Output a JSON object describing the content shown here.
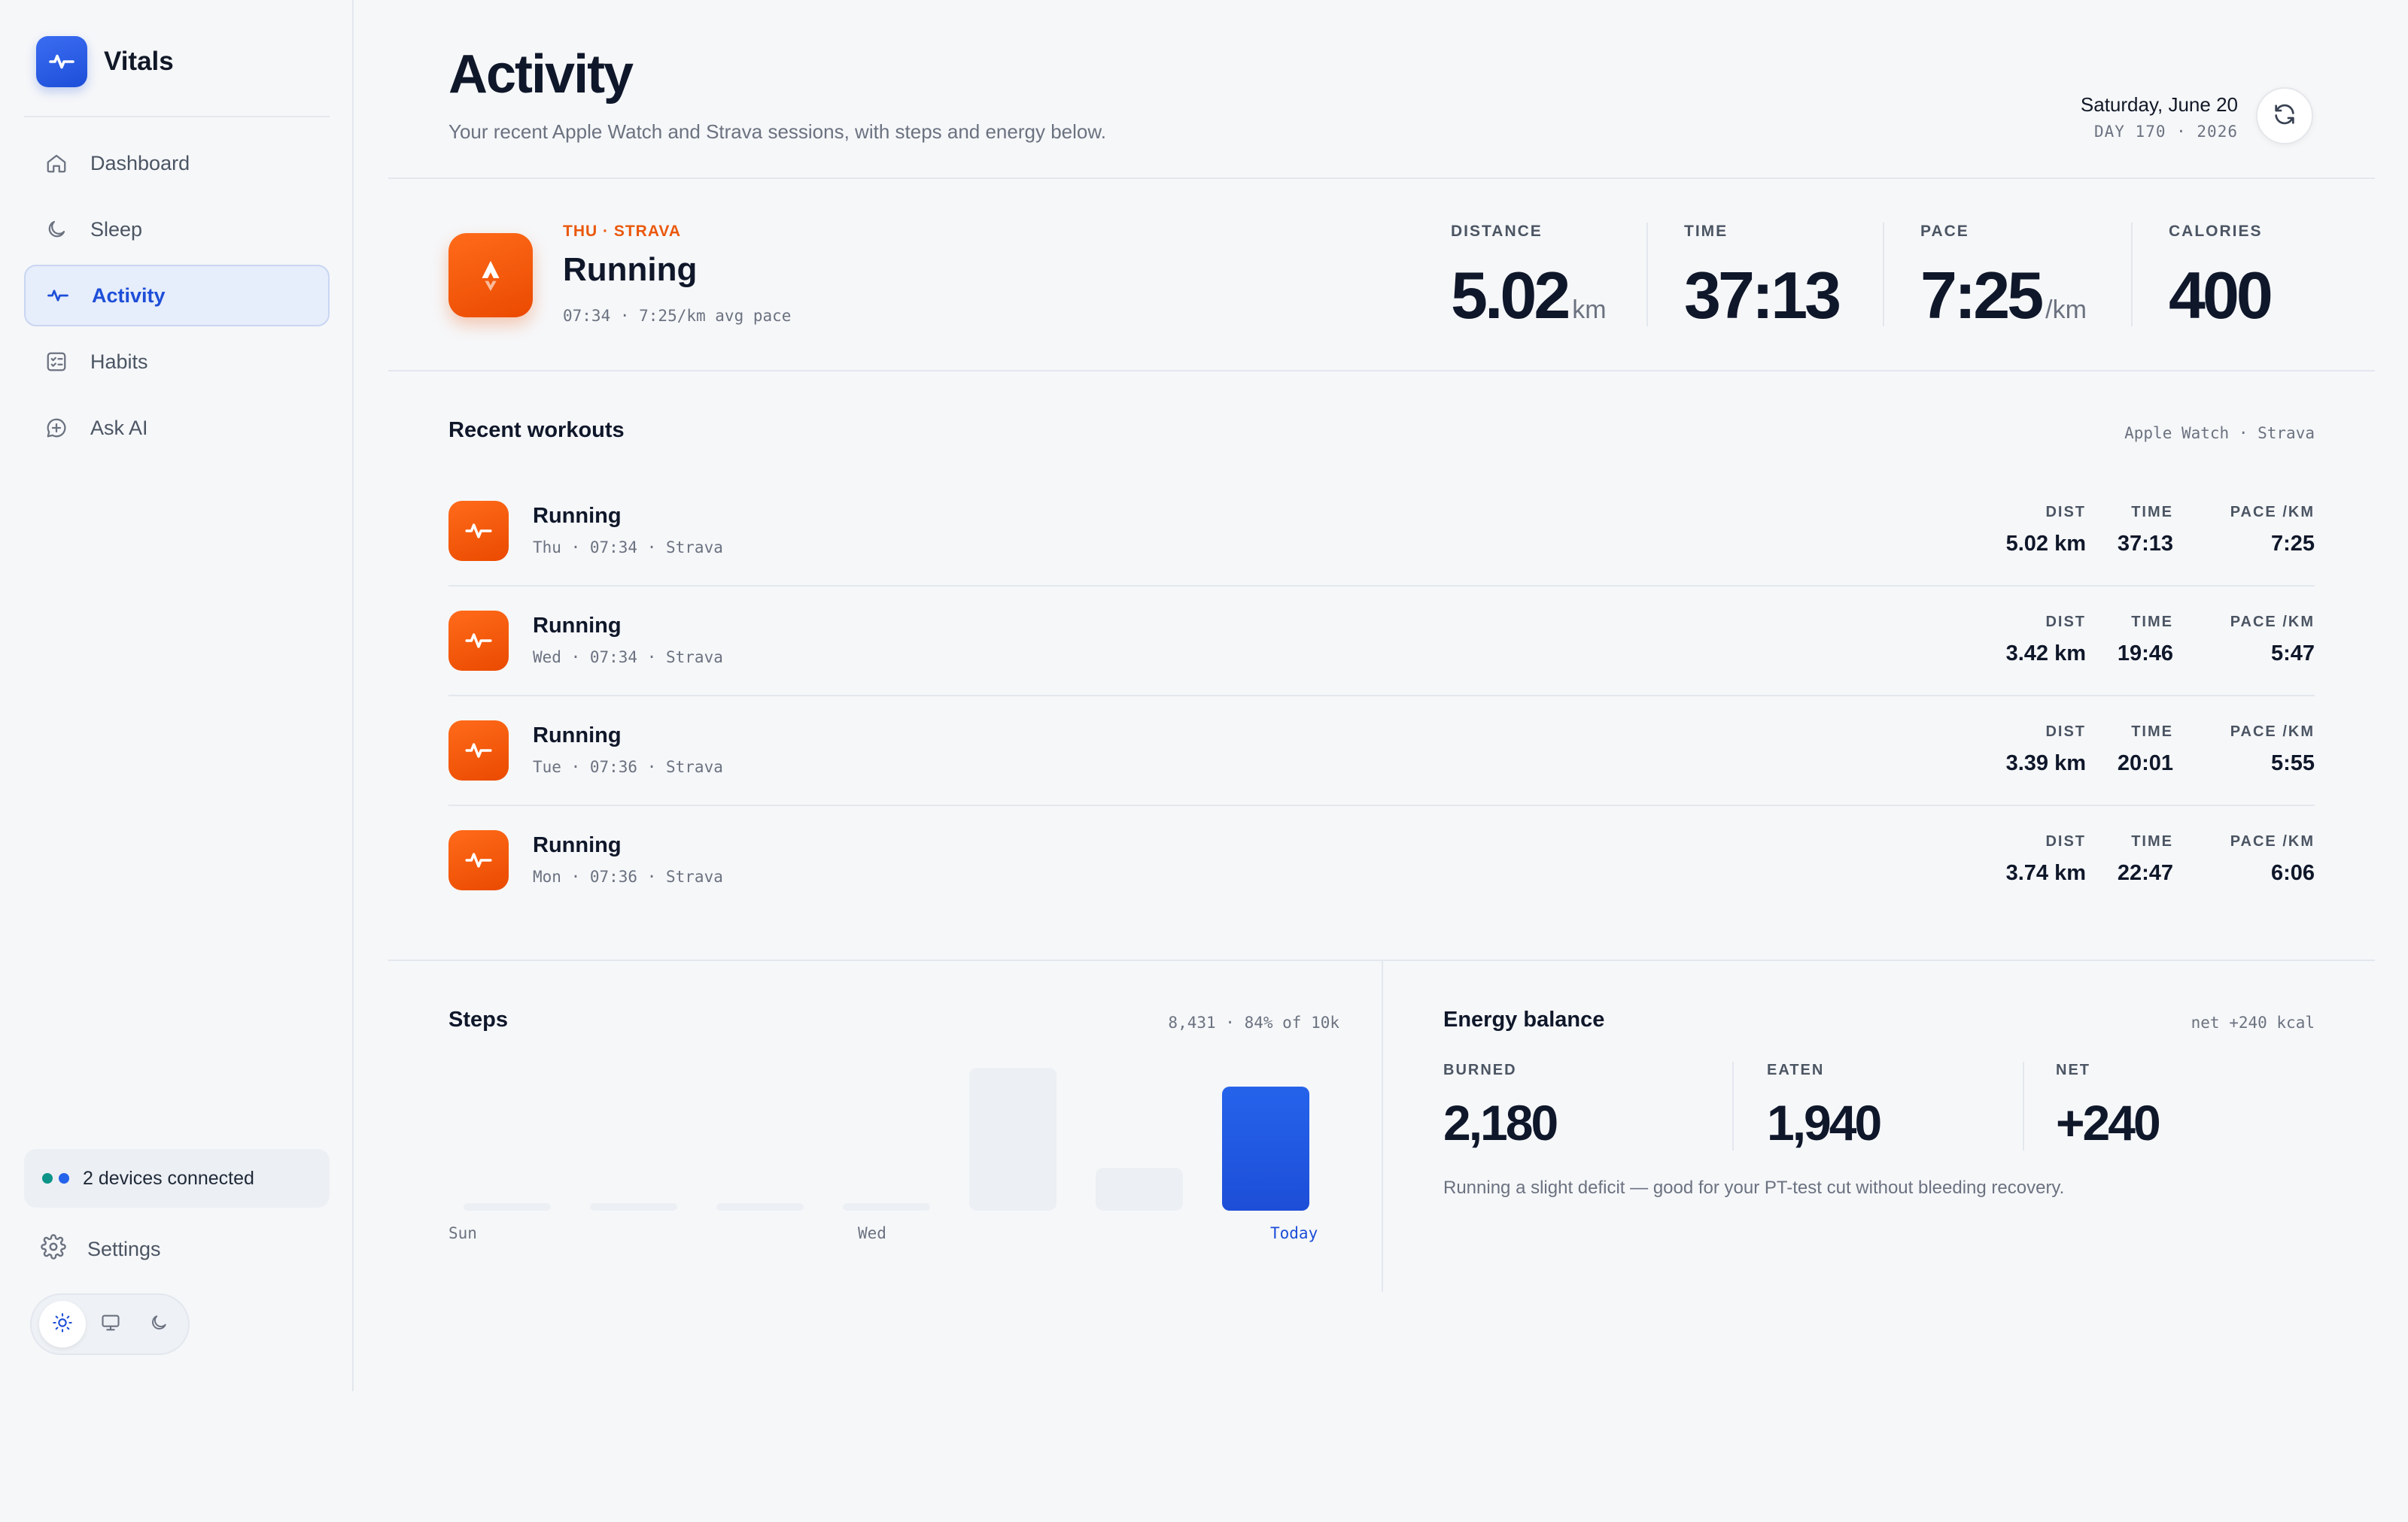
{
  "app": {
    "name": "Vitals"
  },
  "sidebar": {
    "items": [
      {
        "label": "Dashboard",
        "icon": "home-icon"
      },
      {
        "label": "Sleep",
        "icon": "moon-icon"
      },
      {
        "label": "Activity",
        "icon": "pulse-icon",
        "active": true
      },
      {
        "label": "Habits",
        "icon": "checklist-icon"
      },
      {
        "label": "Ask AI",
        "icon": "chat-sparkle-icon"
      }
    ],
    "devices": {
      "label": "2 devices connected",
      "dot_colors": [
        "#0d9488",
        "#2563eb"
      ]
    },
    "settings": {
      "label": "Settings",
      "icon": "gear-icon"
    },
    "theme": {
      "options": [
        "sun-icon",
        "monitor-icon",
        "moon-icon"
      ],
      "selected": "sun-icon"
    }
  },
  "header": {
    "title": "Activity",
    "subtitle": "Your recent Apple Watch and Strava sessions, with steps and energy below.",
    "date": "Saturday, June 20",
    "date_sub": "DAY 170 · 2026"
  },
  "hero": {
    "eyebrow": "THU · STRAVA",
    "title": "Running",
    "meta": "07:34 · 7:25/km avg pace",
    "stats": [
      {
        "label": "DISTANCE",
        "value": "5.02",
        "unit": "km"
      },
      {
        "label": "TIME",
        "value": "37:13",
        "unit": ""
      },
      {
        "label": "PACE",
        "value": "7:25",
        "unit": "/km"
      },
      {
        "label": "CALORIES",
        "value": "400",
        "unit": ""
      }
    ]
  },
  "workouts": {
    "title": "Recent workouts",
    "source_note": "Apple Watch · Strava",
    "columns": [
      "DIST",
      "TIME",
      "PACE /KM"
    ],
    "rows": [
      {
        "title": "Running",
        "meta": "Thu · 07:34 · Strava",
        "dist": "5.02 km",
        "time": "37:13",
        "pace": "7:25"
      },
      {
        "title": "Running",
        "meta": "Wed · 07:34 · Strava",
        "dist": "3.42 km",
        "time": "19:46",
        "pace": "5:47"
      },
      {
        "title": "Running",
        "meta": "Tue · 07:36 · Strava",
        "dist": "3.39 km",
        "time": "20:01",
        "pace": "5:55"
      },
      {
        "title": "Running",
        "meta": "Mon · 07:36 · Strava",
        "dist": "3.74 km",
        "time": "22:47",
        "pace": "6:06"
      }
    ]
  },
  "steps": {
    "title": "Steps",
    "summary": "8,431 · 84% of 10k",
    "labels": {
      "first": "Sun",
      "middle": "Wed",
      "last": "Today"
    },
    "daily_fraction_of_max": [
      0.05,
      0.05,
      0.05,
      0.05,
      1.0,
      0.3,
      0.87
    ]
  },
  "energy": {
    "title": "Energy balance",
    "summary": "net +240 kcal",
    "stats": [
      {
        "label": "BURNED",
        "value": "2,180"
      },
      {
        "label": "EATEN",
        "value": "1,940"
      },
      {
        "label": "NET",
        "value": "+240"
      }
    ],
    "note": "Running a slight deficit — good for your PT-test cut without bleeding recovery."
  },
  "colors": {
    "accent": "#1d4ed8",
    "strava_orange": "#ea580c",
    "background": "#f6f7f9"
  }
}
